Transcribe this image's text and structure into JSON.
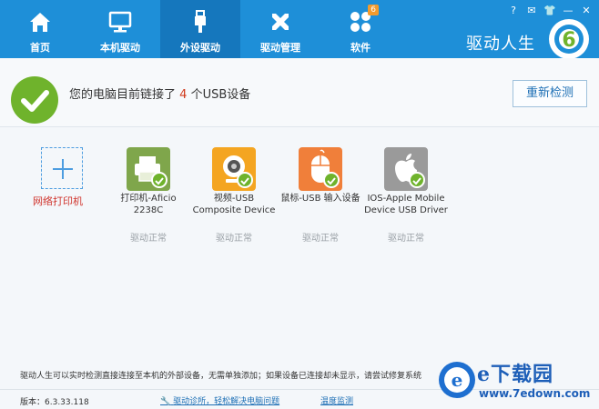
{
  "nav": {
    "items": [
      {
        "label": "首页",
        "icon": "home-icon"
      },
      {
        "label": "本机驱动",
        "icon": "monitor-icon"
      },
      {
        "label": "外设驱动",
        "icon": "usb-icon",
        "active": true
      },
      {
        "label": "驱动管理",
        "icon": "tools-icon"
      },
      {
        "label": "软件",
        "icon": "apps-icon",
        "badge": "6"
      }
    ]
  },
  "window": {
    "brand": "驱动人生",
    "controls": [
      "?",
      "✉",
      "👕",
      "—",
      "✕"
    ]
  },
  "status": {
    "text_before": "您的电脑目前链接了",
    "count": "4",
    "text_after": "个USB设备",
    "rescan_label": "重新检测"
  },
  "add_printer": {
    "label": "网络打印机"
  },
  "devices": [
    {
      "name_line1": "打印机-Aficio",
      "name_line2": "2238C",
      "status": "驱动正常",
      "icon": "printer-icon",
      "color": "#7fa64b"
    },
    {
      "name_line1": "视频-USB",
      "name_line2": "Composite Device",
      "status": "驱动正常",
      "icon": "webcam-icon",
      "color": "#f4a521"
    },
    {
      "name_line1": "鼠标-USB 输入设备",
      "name_line2": "",
      "status": "驱动正常",
      "icon": "mouse-icon",
      "color": "#f07f3a"
    },
    {
      "name_line1": "IOS-Apple Mobile",
      "name_line2": "Device USB Driver",
      "status": "驱动正常",
      "icon": "apple-icon",
      "color": "#9a9a9a"
    }
  ],
  "footer": {
    "notice": "驱动人生可以实时检测直接连接至本机的外部设备，无需单独添加；如果设备已连接却未显示，请尝试修复系统",
    "version": "版本：6.3.33.118",
    "diag_link": "驱动诊所，轻松解决电脑问题",
    "temp_link": "温度监测"
  },
  "watermark": {
    "title": "e下载园",
    "url": "www.7edown.com"
  },
  "colors": {
    "topbar": "#1e8fd8",
    "active_tab": "#1577bd",
    "ok_green": "#6fb32c",
    "count_red": "#d03a1b",
    "link_blue": "#1d6fb5"
  }
}
